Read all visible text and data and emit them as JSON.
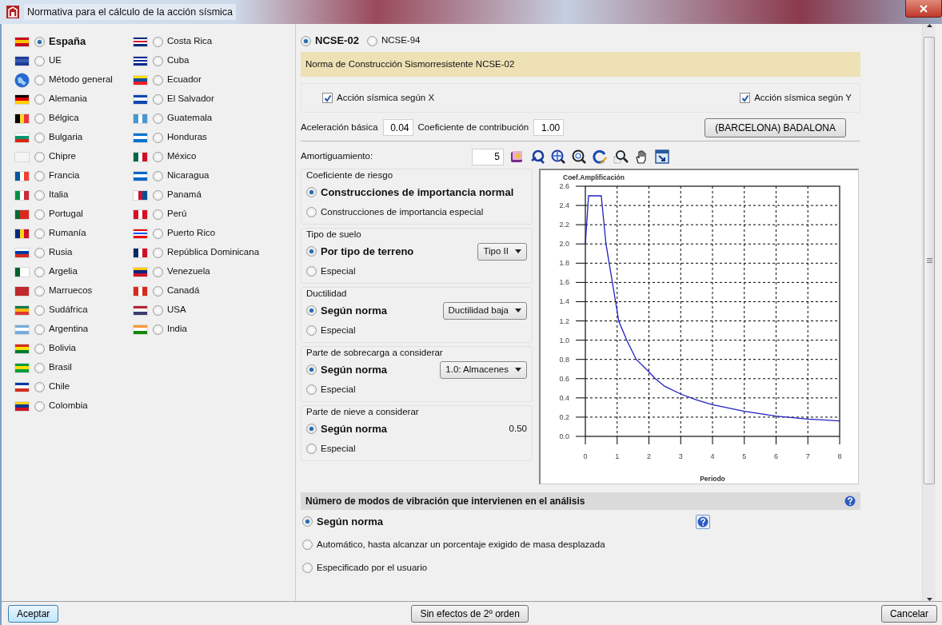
{
  "window": {
    "title": "Normativa para el cálculo de la acción sísmica"
  },
  "country_columns": [
    {
      "items": [
        {
          "name": "España",
          "selected": true
        },
        {
          "name": "UE",
          "selected": false
        },
        {
          "name": "Método general",
          "selected": false
        },
        {
          "name": "Alemania",
          "selected": false
        },
        {
          "name": "Bélgica",
          "selected": false
        },
        {
          "name": "Bulgaria",
          "selected": false
        },
        {
          "name": "Chipre",
          "selected": false
        },
        {
          "name": "Francia",
          "selected": false
        },
        {
          "name": "Italia",
          "selected": false
        },
        {
          "name": "Portugal",
          "selected": false
        },
        {
          "name": "Rumanía",
          "selected": false
        },
        {
          "name": "Rusia",
          "selected": false
        },
        {
          "name": "Argelia",
          "selected": false
        },
        {
          "name": "Marruecos",
          "selected": false
        },
        {
          "name": "Sudáfrica",
          "selected": false
        },
        {
          "name": "Argentina",
          "selected": false
        },
        {
          "name": "Bolivia",
          "selected": false
        },
        {
          "name": "Brasil",
          "selected": false
        },
        {
          "name": "Chile",
          "selected": false
        },
        {
          "name": "Colombia",
          "selected": false
        }
      ]
    },
    {
      "items": [
        {
          "name": "Costa Rica",
          "selected": false
        },
        {
          "name": "Cuba",
          "selected": false
        },
        {
          "name": "Ecuador",
          "selected": false
        },
        {
          "name": "El Salvador",
          "selected": false
        },
        {
          "name": "Guatemala",
          "selected": false
        },
        {
          "name": "Honduras",
          "selected": false
        },
        {
          "name": "México",
          "selected": false
        },
        {
          "name": "Nicaragua",
          "selected": false
        },
        {
          "name": "Panamá",
          "selected": false
        },
        {
          "name": "Perú",
          "selected": false
        },
        {
          "name": "Puerto Rico",
          "selected": false
        },
        {
          "name": "República Dominicana",
          "selected": false
        },
        {
          "name": "Venezuela",
          "selected": false
        },
        {
          "name": "Canadá",
          "selected": false
        },
        {
          "name": "USA",
          "selected": false
        },
        {
          "name": "India",
          "selected": false
        }
      ]
    }
  ],
  "norms": [
    {
      "label": "NCSE-02",
      "selected": true
    },
    {
      "label": "NCSE-94",
      "selected": false
    }
  ],
  "norm_banner": "Norma de Construcción Sismorresistente NCSE-02",
  "seismic_x": {
    "label": "Acción sísmica según X",
    "checked": true
  },
  "seismic_y": {
    "label": "Acción sísmica según Y",
    "checked": true
  },
  "basic_acceleration": {
    "label": "Aceleración básica",
    "value": "0.04"
  },
  "contribution": {
    "label": "Coeficiente de contribución",
    "value": "1.00"
  },
  "location_button": "(BARCELONA) BADALONA",
  "damping": {
    "label": "Amortiguamiento:",
    "value": "5"
  },
  "groups": [
    {
      "title": "Coeficiente de riesgo",
      "options": [
        {
          "label": "Construcciones de importancia normal",
          "selected": true
        },
        {
          "label": "Construcciones de importancia especial",
          "selected": false
        }
      ]
    },
    {
      "title": "Tipo de suelo",
      "options": [
        {
          "label": "Por tipo de terreno",
          "selected": true
        },
        {
          "label": "Especial",
          "selected": false
        }
      ],
      "control": {
        "kind": "select",
        "value": "Tipo II"
      }
    },
    {
      "title": "Ductilidad",
      "options": [
        {
          "label": "Según norma",
          "selected": true
        },
        {
          "label": "Especial",
          "selected": false
        }
      ],
      "control": {
        "kind": "select",
        "value": "Ductilidad baja"
      }
    },
    {
      "title": "Parte de sobrecarga a considerar",
      "options": [
        {
          "label": "Según norma",
          "selected": true
        },
        {
          "label": "Especial",
          "selected": false
        }
      ],
      "control": {
        "kind": "select",
        "value": "1.0: Almacenes"
      }
    },
    {
      "title": "Parte de nieve a considerar",
      "options": [
        {
          "label": "Según norma",
          "selected": true
        },
        {
          "label": "Especial",
          "selected": false
        }
      ],
      "control": {
        "kind": "reading",
        "value": "0.50"
      }
    }
  ],
  "chart": {
    "chart_data": {
      "type": "line",
      "ylabel": "Coef.Amplificación",
      "xlabel": "Periodo",
      "x": [
        0,
        0.1,
        0.5,
        0.65,
        0.75,
        0.85,
        0.95,
        1.05,
        1.3,
        1.6,
        2,
        2.2,
        2.5,
        3,
        3.5,
        4,
        5,
        6,
        7,
        8
      ],
      "grid": true,
      "series": [
        {
          "color": "#2020c0",
          "values": [
            2.0,
            2.5,
            2.5,
            2.0,
            1.8,
            1.6,
            1.4,
            1.2,
            1.0,
            0.8,
            0.67,
            0.6,
            0.52,
            0.44,
            0.38,
            0.33,
            0.26,
            0.21,
            0.18,
            0.16
          ]
        }
      ],
      "xlim": [
        0,
        8
      ],
      "ylim": [
        0,
        2.6
      ],
      "xticks": [
        0,
        1,
        2,
        3,
        4,
        5,
        6,
        7,
        8
      ],
      "yticks": [
        {
          "value": 0,
          "label": "0.0"
        },
        {
          "value": 0.2,
          "label": "0.2"
        },
        {
          "value": 0.4,
          "label": "0.4"
        },
        {
          "value": 0.6,
          "label": "0.6"
        },
        {
          "value": 0.8,
          "label": "0.8"
        },
        {
          "value": 1,
          "label": "1.0"
        },
        {
          "value": 1.2,
          "label": "1.2"
        },
        {
          "value": 1.4,
          "label": "1.4"
        },
        {
          "value": 1.6,
          "label": "1.6"
        },
        {
          "value": 1.8,
          "label": "1.8"
        },
        {
          "value": 2,
          "label": "2.0"
        },
        {
          "value": 2.2,
          "label": "2.2"
        },
        {
          "value": 2.4,
          "label": "2.4"
        },
        {
          "value": 2.6,
          "label": "2.6"
        }
      ]
    }
  },
  "modes": {
    "title": "Número de modos de vibración que intervienen en el análisis",
    "options": [
      {
        "label": "Según norma",
        "selected": true
      },
      {
        "label": "Automático, hasta alcanzar un porcentaje exigido de masa desplazada",
        "selected": false
      },
      {
        "label": "Especificado por el usuario",
        "selected": false
      }
    ]
  },
  "buttons": {
    "accept": "Aceptar",
    "second_order": "Sin efectos de 2º orden",
    "cancel": "Cancelar"
  }
}
